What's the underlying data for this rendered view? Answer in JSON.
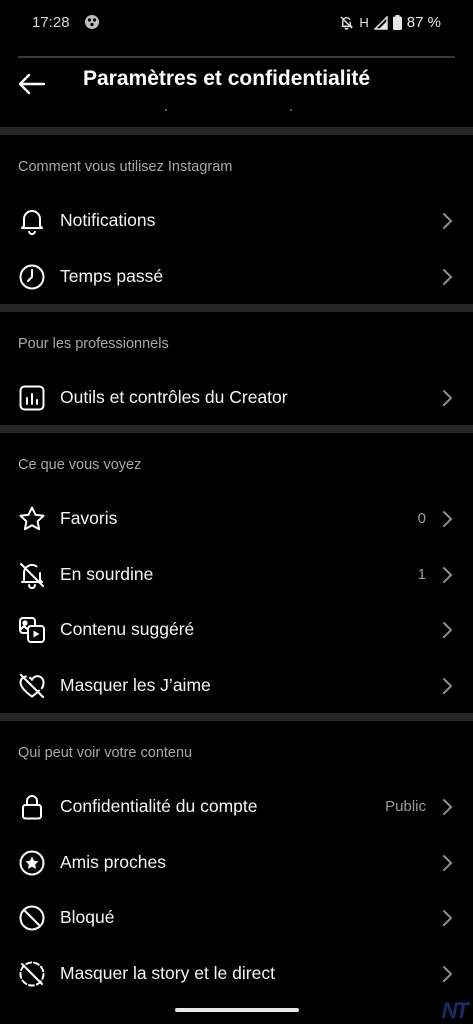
{
  "status_bar": {
    "time": "17:28",
    "network": "H",
    "battery": "87 %"
  },
  "header": {
    "title": "Paramètres et confidentialité"
  },
  "sections": [
    {
      "title": "Comment vous utilisez Instagram",
      "items": [
        {
          "label": "Notifications",
          "icon": "bell-icon",
          "value": ""
        },
        {
          "label": "Temps passé",
          "icon": "clock-icon",
          "value": ""
        }
      ]
    },
    {
      "title": "Pour les professionnels",
      "items": [
        {
          "label": "Outils et contrôles du Creator",
          "icon": "chart-icon",
          "value": ""
        }
      ]
    },
    {
      "title": "Ce que vous voyez",
      "items": [
        {
          "label": "Favoris",
          "icon": "star-icon",
          "value": "0"
        },
        {
          "label": "En sourdine",
          "icon": "muted-bell-icon",
          "value": "1"
        },
        {
          "label": "Contenu suggéré",
          "icon": "suggested-content-icon",
          "value": ""
        },
        {
          "label": "Masquer les J’aime",
          "icon": "heart-off-icon",
          "value": ""
        }
      ]
    },
    {
      "title": "Qui peut voir votre contenu",
      "items": [
        {
          "label": "Confidentialité du compte",
          "icon": "lock-icon",
          "value": "Public"
        },
        {
          "label": "Amis proches",
          "icon": "close-friends-star-icon",
          "value": ""
        },
        {
          "label": "Bloqué",
          "icon": "blocked-icon",
          "value": ""
        },
        {
          "label": "Masquer la story et le direct",
          "icon": "story-off-icon",
          "value": ""
        }
      ]
    }
  ],
  "watermark": "NT"
}
